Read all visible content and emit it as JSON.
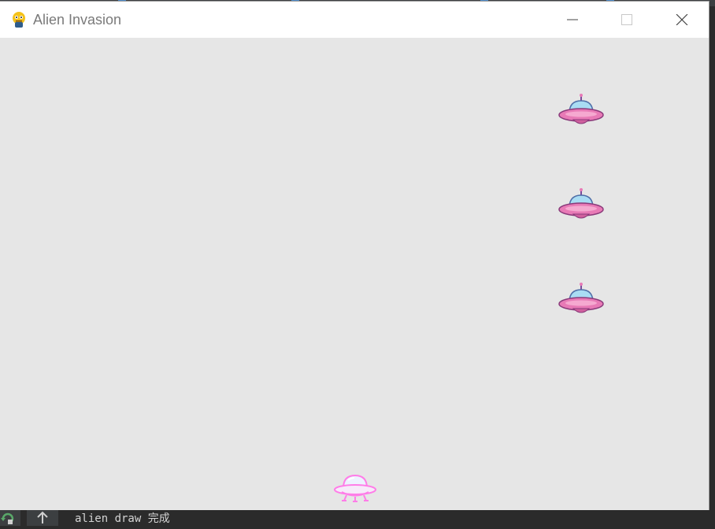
{
  "window": {
    "title": "Alien Invasion",
    "app_icon": "pygame-snake-icon",
    "controls": [
      "minimize-icon",
      "maximize-icon",
      "close-icon"
    ]
  },
  "game": {
    "background_color": "#e6e6e6",
    "alien_count": 3,
    "alien_colors": {
      "saucer": "#e87ab6",
      "dome": "#a9dcf3"
    },
    "ship_color": "#ff88ee"
  },
  "console": {
    "output": "alien draw 完成",
    "buttons": [
      "rerun-icon",
      "scroll-up-icon"
    ]
  }
}
